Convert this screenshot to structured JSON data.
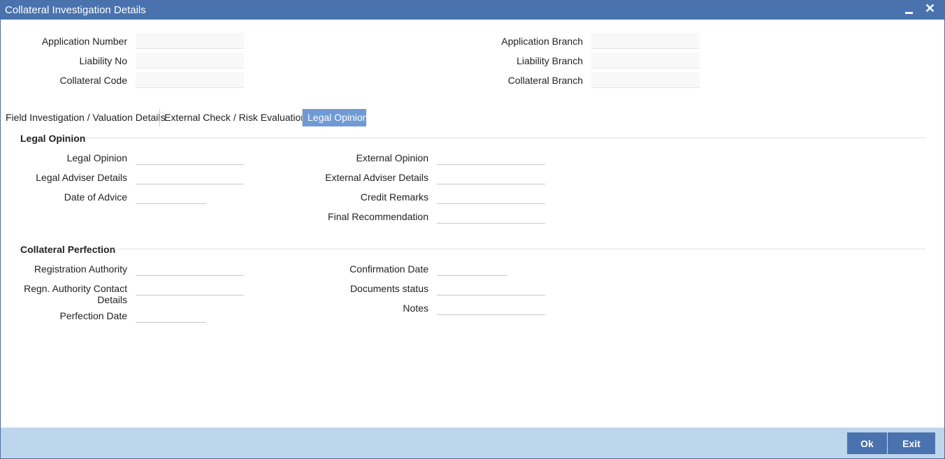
{
  "window": {
    "title": "Collateral Investigation Details",
    "minimize_icon": "minimize-icon",
    "close_icon": "close-icon"
  },
  "header": {
    "application_number": {
      "label": "Application Number",
      "value": ""
    },
    "liability_no": {
      "label": "Liability No",
      "value": ""
    },
    "collateral_code": {
      "label": "Collateral Code",
      "value": ""
    },
    "application_branch": {
      "label": "Application Branch",
      "value": ""
    },
    "liability_branch": {
      "label": "Liability Branch",
      "value": ""
    },
    "collateral_branch": {
      "label": "Collateral Branch",
      "value": ""
    }
  },
  "tabs": [
    {
      "label": "Field Investigation / Valuation Details",
      "active": false
    },
    {
      "label": "External Check / Risk Evaluation",
      "active": false
    },
    {
      "label": "Legal Opinion",
      "active": true
    }
  ],
  "legal_opinion": {
    "section_title": "Legal Opinion",
    "legal_opinion": {
      "label": "Legal Opinion",
      "value": ""
    },
    "legal_adviser_details": {
      "label": "Legal Adviser Details",
      "value": ""
    },
    "date_of_advice": {
      "label": "Date of Advice",
      "value": ""
    },
    "external_opinion": {
      "label": "External Opinion",
      "value": ""
    },
    "external_adviser_details": {
      "label": "External Adviser Details",
      "value": ""
    },
    "credit_remarks": {
      "label": "Credit Remarks",
      "value": ""
    },
    "final_recommendation": {
      "label": "Final Recommendation",
      "value": ""
    }
  },
  "collateral_perfection": {
    "section_title": "Collateral Perfection",
    "registration_authority": {
      "label": "Registration Authority",
      "value": ""
    },
    "regn_authority_contact_line1": "Regn. Authority Contact",
    "regn_authority_contact_line2": "Details",
    "regn_authority_contact_value": "",
    "perfection_date": {
      "label": "Perfection Date",
      "value": ""
    },
    "confirmation_date": {
      "label": "Confirmation Date",
      "value": ""
    },
    "documents_status": {
      "label": "Documents status",
      "value": ""
    },
    "notes": {
      "label": "Notes",
      "value": ""
    }
  },
  "footer": {
    "ok_label": "Ok",
    "exit_label": "Exit"
  },
  "colors": {
    "titlebar": "#4a72ae",
    "active_tab": "#6f9ad6",
    "footer": "#bdd6eb",
    "button": "#4a72ae"
  }
}
